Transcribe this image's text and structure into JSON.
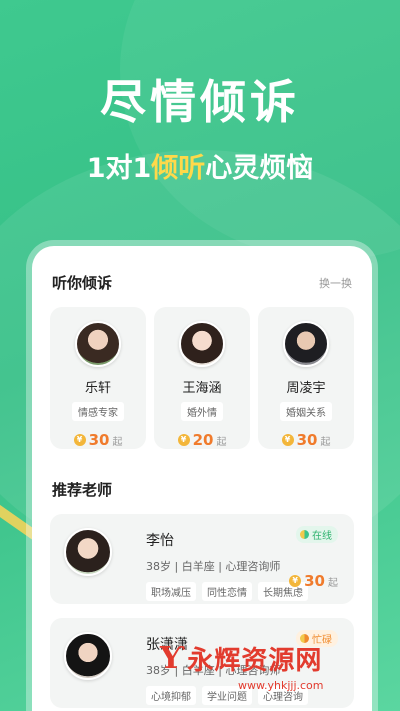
{
  "hero": {
    "title": "尽情倾诉",
    "subtitle_a": "1对1",
    "subtitle_b": "倾听",
    "subtitle_c": "心灵烦恼"
  },
  "listen_section": {
    "title": "听你倾诉",
    "refresh": "换一换",
    "cards": [
      {
        "name": "乐轩",
        "tag": "情感专家",
        "price": "30",
        "unit": "起"
      },
      {
        "name": "王海涵",
        "tag": "婚外情",
        "price": "20",
        "unit": "起"
      },
      {
        "name": "周凌宇",
        "tag": "婚姻关系",
        "price": "30",
        "unit": "起"
      }
    ]
  },
  "teacher_section": {
    "title": "推荐老师",
    "teachers": [
      {
        "name": "李怡",
        "meta": "38岁 | 白羊座 | 心理咨询师",
        "tags": [
          "职场减压",
          "同性恋情",
          "长期焦虑"
        ],
        "status": "在线",
        "price": "30",
        "unit": "起"
      },
      {
        "name": "张潇潇",
        "meta": "38岁 | 白羊座 | 心理咨询师",
        "tags": [
          "心境抑郁",
          "学业问题",
          "心理咨询"
        ],
        "status": "忙碌"
      }
    ]
  },
  "watermark": {
    "brand": "永辉资源网",
    "url": "www.yhkjjj.com"
  },
  "icons": {
    "coin": "coin-icon",
    "status_dot": "status-dot-icon"
  },
  "colors": {
    "brand_green": "#3cc48a",
    "highlight_yellow": "#ffd94a",
    "price_orange": "#f07b2c"
  }
}
